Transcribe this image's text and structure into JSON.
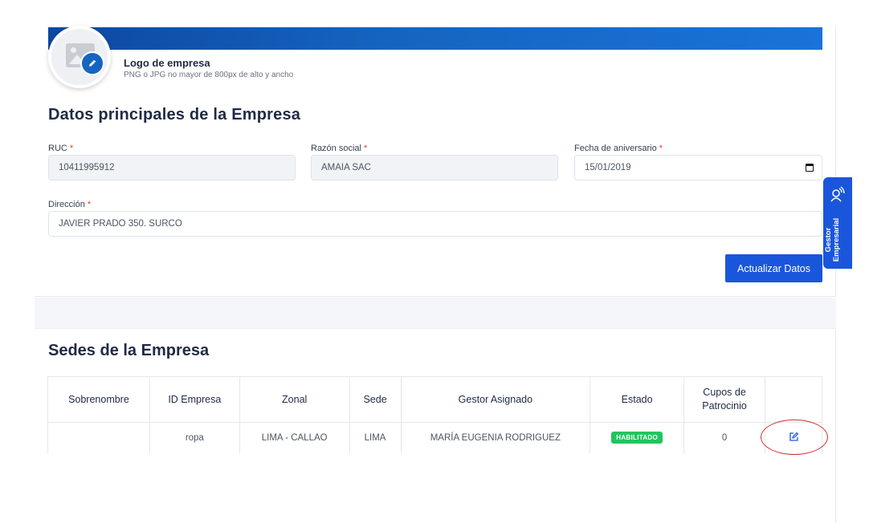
{
  "logo": {
    "title": "Logo de empresa",
    "subtitle": "PNG o JPG no mayor de 800px de alto y ancho"
  },
  "datos": {
    "heading": "Datos principales de la Empresa",
    "ruc": {
      "label": "RUC",
      "value": "10411995912"
    },
    "razon": {
      "label": "Razón social",
      "value": "AMAIA SAC"
    },
    "fecha": {
      "label": "Fecha de aniversario",
      "value": "15/01/2019"
    },
    "direccion": {
      "label": "Dirección",
      "value": "JAVIER PRADO 350. SURCO"
    },
    "required_mark": "*",
    "update_button": "Actualizar Datos"
  },
  "side_tab": {
    "label_line1": "Gestor",
    "label_line2": "Empresarial"
  },
  "sedes": {
    "heading": "Sedes de la Empresa",
    "columns": [
      "Sobrenombre",
      "ID Empresa",
      "Zonal",
      "Sede",
      "Gestor Asignado",
      "Estado",
      "Cupos de Patrocinio",
      ""
    ],
    "rows": [
      {
        "sobrenombre": "",
        "id_empresa": "ropa",
        "zonal": "LIMA - CALLAO",
        "sede": "LIMA",
        "gestor": "MARÍA EUGENIA RODRIGUEZ",
        "estado": "HABILITADO",
        "cupos": "0"
      }
    ]
  },
  "colors": {
    "primary": "#1a56db",
    "banner": "#1565c0",
    "success": "#22c55e",
    "annotation": "#d32f2f"
  },
  "icons": {
    "logo_placeholder": "image-icon",
    "edit_badge": "pencil-icon",
    "side_tab": "gestor-icon",
    "row_edit": "edit-square-icon",
    "date_picker": "calendar-icon"
  }
}
